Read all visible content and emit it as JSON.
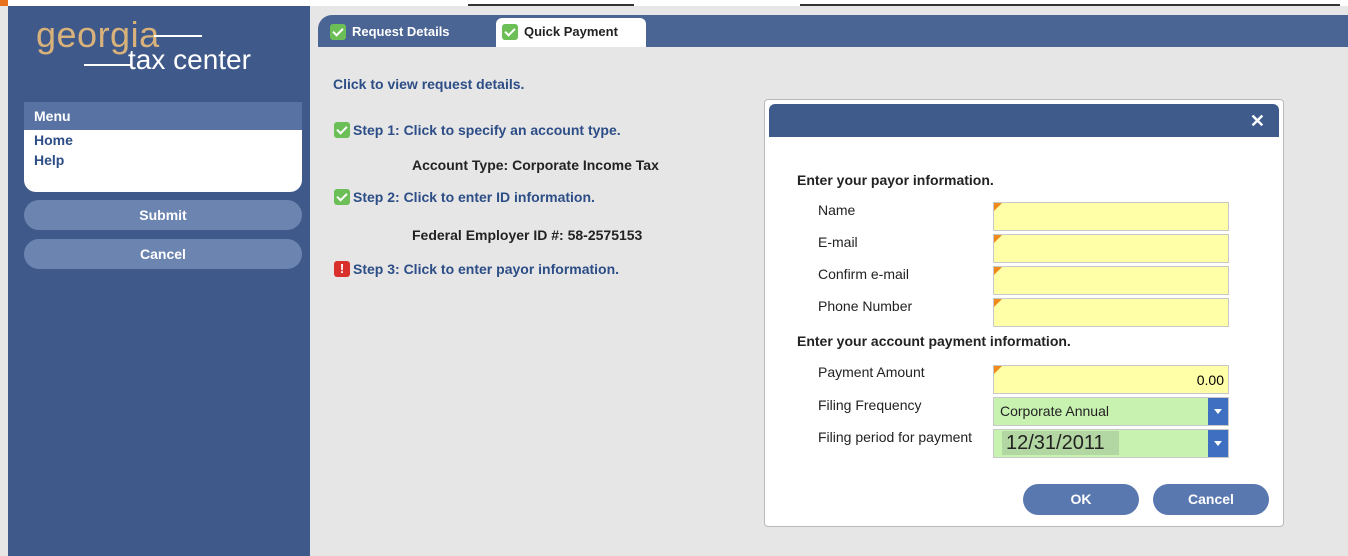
{
  "logo": {
    "line1": "georgia",
    "line2": "tax center"
  },
  "menu": {
    "header": "Menu",
    "items": [
      {
        "label": "Home"
      },
      {
        "label": "Help"
      }
    ],
    "submit_label": "Submit",
    "cancel_label": "Cancel"
  },
  "tabs": [
    {
      "label": "Request Details",
      "status": "complete"
    },
    {
      "label": "Quick Payment",
      "status": "complete",
      "active": true
    }
  ],
  "view_details_link": "Click to view request details.",
  "steps": [
    {
      "label": "Step 1: Click to specify an account type.",
      "status": "complete",
      "detail": "Account Type: Corporate Income Tax"
    },
    {
      "label": "Step 2: Click to enter ID information.",
      "status": "complete",
      "detail": "Federal Employer ID #: 58-2575153"
    },
    {
      "label": "Step 3: Click to enter payor information.",
      "status": "error"
    }
  ],
  "dialog": {
    "close_icon": "close-icon",
    "payor_heading": "Enter your payor information.",
    "payor_fields": [
      {
        "label": "Name",
        "value": ""
      },
      {
        "label": "E-mail",
        "value": ""
      },
      {
        "label": "Confirm e-mail",
        "value": ""
      },
      {
        "label": "Phone Number",
        "value": ""
      }
    ],
    "payment_heading": "Enter your account payment information.",
    "payment_amount": {
      "label": "Payment Amount",
      "value": "0.00"
    },
    "filing_frequency": {
      "label": "Filing Frequency",
      "value": "Corporate Annual"
    },
    "filing_period": {
      "label": "Filing period for payment",
      "value": "12/31/2011"
    },
    "ok_label": "OK",
    "cancel_label": "Cancel"
  },
  "colors": {
    "sidebar_bg": "#3f5a8a",
    "tabbar_bg": "#4a6494",
    "required_field_bg": "#ffffa8",
    "select_bg": "#c8f2b0",
    "check_green": "#6cbf56",
    "error_red": "#d9302c",
    "link_blue": "#2c4d86"
  }
}
